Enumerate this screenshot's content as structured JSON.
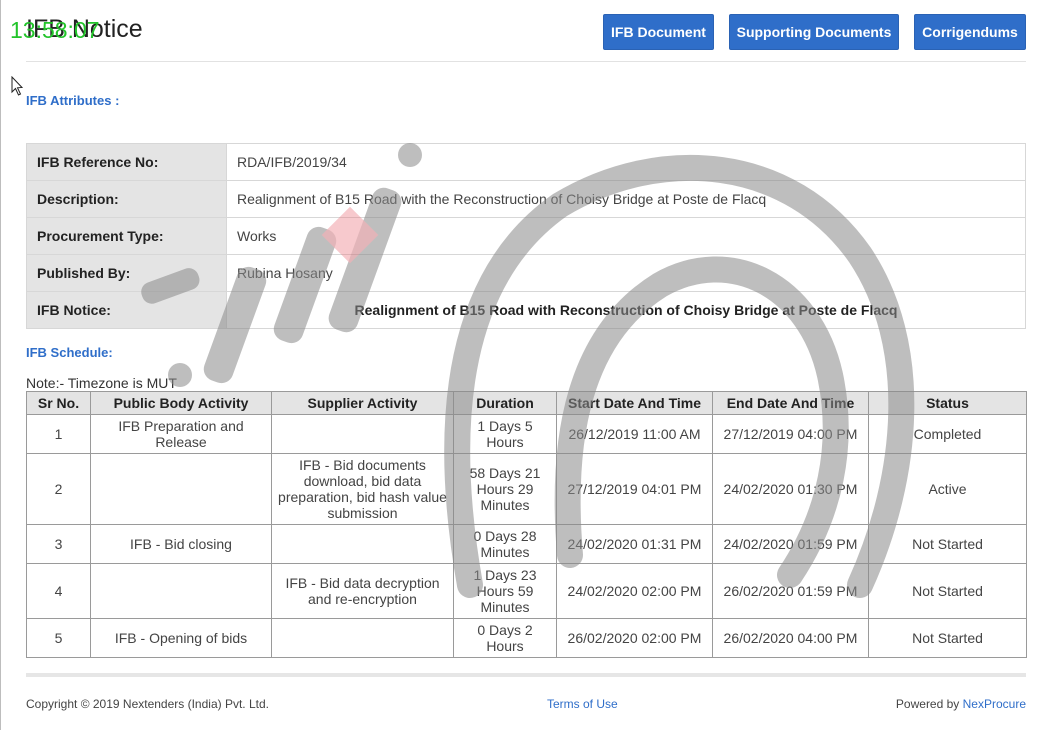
{
  "overlay": {
    "time": "13:58:07"
  },
  "header": {
    "title": "IFB Notice",
    "buttons": {
      "ifb_document": "IFB Document",
      "supporting_documents": "Supporting Documents",
      "corrigendums": "Corrigendums"
    }
  },
  "attributes": {
    "section_title": "IFB Attributes :",
    "rows": [
      {
        "label": "IFB Reference No:",
        "value": "RDA/IFB/2019/34"
      },
      {
        "label": "Description:",
        "value": "Realignment of B15 Road with the Reconstruction of Choisy Bridge at Poste de Flacq"
      },
      {
        "label": "Procurement Type:",
        "value": "Works"
      },
      {
        "label": "Published By:",
        "value": "Rubina Hosany"
      },
      {
        "label": "IFB Notice:",
        "value": "Realignment of B15 Road with Reconstruction of Choisy Bridge at Poste de Flacq"
      }
    ]
  },
  "schedule": {
    "section_title": "IFB Schedule:",
    "note": "Note:- Timezone is MUT",
    "columns": [
      "Sr No.",
      "Public Body Activity",
      "Supplier Activity",
      "Duration",
      "Start Date And Time",
      "End Date And Time",
      "Status"
    ],
    "rows": [
      {
        "sr": "1",
        "public": "IFB Preparation and Release",
        "supplier": "",
        "duration": "1 Days 5 Hours",
        "start": "26/12/2019 11:00 AM",
        "end": "27/12/2019 04:00 PM",
        "status": "Completed"
      },
      {
        "sr": "2",
        "public": "",
        "supplier": "IFB - Bid documents download, bid data preparation, bid hash value submission",
        "duration": "58 Days 21 Hours 29 Minutes",
        "start": "27/12/2019 04:01 PM",
        "end": "24/02/2020 01:30 PM",
        "status": "Active"
      },
      {
        "sr": "3",
        "public": "IFB - Bid closing",
        "supplier": "",
        "duration": "0 Days 28 Minutes",
        "start": "24/02/2020 01:31 PM",
        "end": "24/02/2020 01:59 PM",
        "status": "Not Started"
      },
      {
        "sr": "4",
        "public": "",
        "supplier": "IFB - Bid data decryption and re-encryption",
        "duration": "1 Days 23 Hours 59 Minutes",
        "start": "24/02/2020 02:00 PM",
        "end": "26/02/2020 01:59 PM",
        "status": "Not Started"
      },
      {
        "sr": "5",
        "public": "IFB - Opening of bids",
        "supplier": "",
        "duration": "0 Days 2 Hours",
        "start": "26/02/2020 02:00 PM",
        "end": "26/02/2020 04:00 PM",
        "status": "Not Started"
      }
    ]
  },
  "footer": {
    "copyright": "Copyright © 2019 Nextenders (India) Pvt. Ltd.",
    "terms": "Terms of Use",
    "powered_prefix": "Powered by",
    "powered_link": "NexProcure"
  },
  "colors": {
    "primary": "#2f6ec9",
    "overlay_time": "#22c42a",
    "label_bg": "#e4e4e4"
  }
}
